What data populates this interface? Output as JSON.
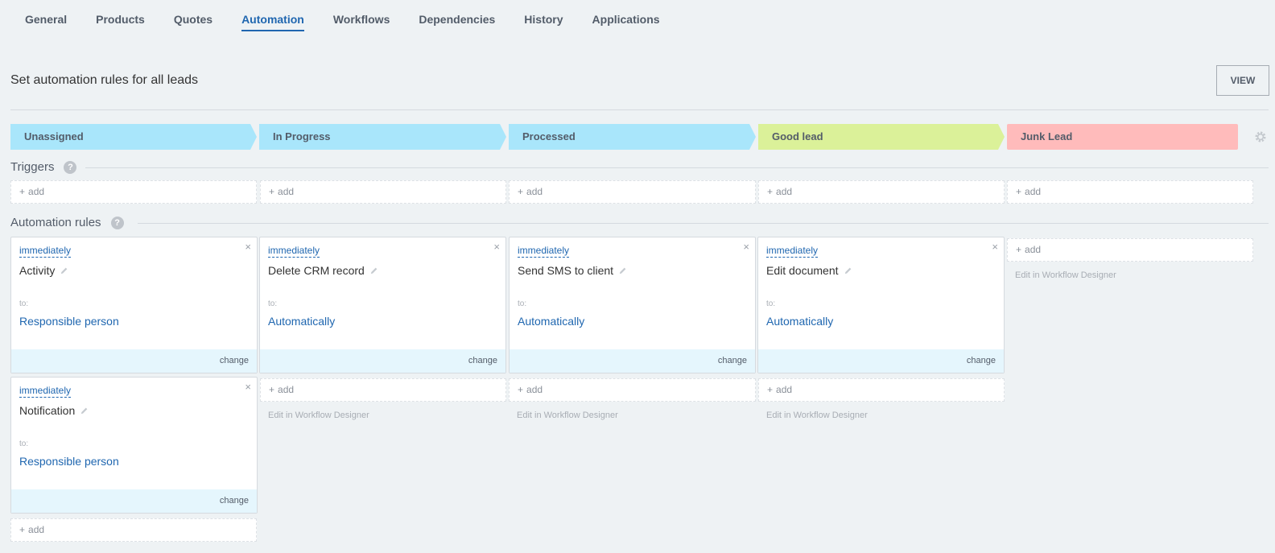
{
  "tabs": [
    "General",
    "Products",
    "Quotes",
    "Automation",
    "Workflows",
    "Dependencies",
    "History",
    "Applications"
  ],
  "header": {
    "title": "Set automation rules for all leads",
    "view_label": "VIEW"
  },
  "stages": [
    {
      "label": "Unassigned",
      "color": "#a9e6fb"
    },
    {
      "label": "In Progress",
      "color": "#a9e6fb"
    },
    {
      "label": "Processed",
      "color": "#a9e6fb"
    },
    {
      "label": "Good lead",
      "color": "#dbf199"
    },
    {
      "label": "Junk Lead",
      "color": "#ffbbbb"
    }
  ],
  "sections": {
    "triggers": "Triggers",
    "rules": "Automation rules",
    "help": "?"
  },
  "add_label": "add",
  "add_plus": "+",
  "close_glyph": "×",
  "rules": [
    {
      "delay": "immediately",
      "name": "Activity",
      "to_label": "to:",
      "responsible": "Responsible person",
      "change": "change"
    },
    {
      "delay": "immediately",
      "name": "Delete CRM record",
      "to_label": "to:",
      "responsible": "Automatically",
      "change": "change"
    },
    {
      "delay": "immediately",
      "name": "Send SMS to client",
      "to_label": "to:",
      "responsible": "Automatically",
      "change": "change"
    },
    {
      "delay": "immediately",
      "name": "Edit document",
      "to_label": "to:",
      "responsible": "Automatically",
      "change": "change"
    },
    {
      "delay": "immediately",
      "name": "Notification",
      "to_label": "to:",
      "responsible": "Responsible person",
      "change": "change"
    }
  ],
  "edit_designer": "Edit in Workflow Designer",
  "colors": {
    "accent": "#2067b0",
    "background": "#eef2f4"
  },
  "icons": {
    "settings": "gear-icon",
    "edit": "pencil-icon",
    "delete": "close-icon",
    "help": "help-icon"
  }
}
